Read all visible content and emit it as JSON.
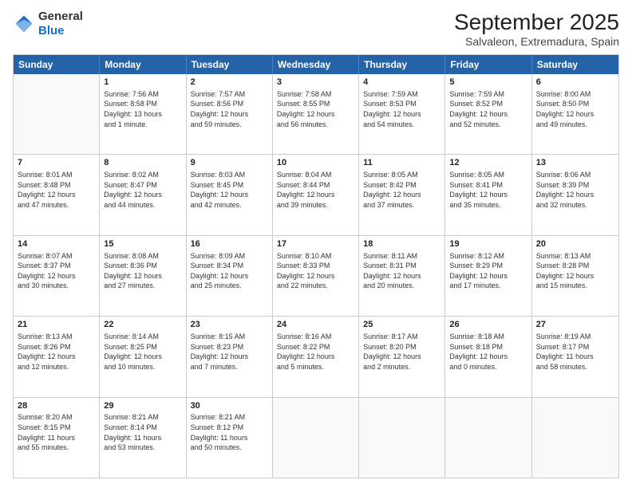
{
  "header": {
    "logo_line1": "General",
    "logo_line2": "Blue",
    "month_title": "September 2025",
    "subtitle": "Salvaleon, Extremadura, Spain"
  },
  "days": [
    "Sunday",
    "Monday",
    "Tuesday",
    "Wednesday",
    "Thursday",
    "Friday",
    "Saturday"
  ],
  "weeks": [
    [
      {
        "day": "",
        "content": ""
      },
      {
        "day": "1",
        "content": "Sunrise: 7:56 AM\nSunset: 8:58 PM\nDaylight: 13 hours\nand 1 minute."
      },
      {
        "day": "2",
        "content": "Sunrise: 7:57 AM\nSunset: 8:56 PM\nDaylight: 12 hours\nand 59 minutes."
      },
      {
        "day": "3",
        "content": "Sunrise: 7:58 AM\nSunset: 8:55 PM\nDaylight: 12 hours\nand 56 minutes."
      },
      {
        "day": "4",
        "content": "Sunrise: 7:59 AM\nSunset: 8:53 PM\nDaylight: 12 hours\nand 54 minutes."
      },
      {
        "day": "5",
        "content": "Sunrise: 7:59 AM\nSunset: 8:52 PM\nDaylight: 12 hours\nand 52 minutes."
      },
      {
        "day": "6",
        "content": "Sunrise: 8:00 AM\nSunset: 8:50 PM\nDaylight: 12 hours\nand 49 minutes."
      }
    ],
    [
      {
        "day": "7",
        "content": "Sunrise: 8:01 AM\nSunset: 8:48 PM\nDaylight: 12 hours\nand 47 minutes."
      },
      {
        "day": "8",
        "content": "Sunrise: 8:02 AM\nSunset: 8:47 PM\nDaylight: 12 hours\nand 44 minutes."
      },
      {
        "day": "9",
        "content": "Sunrise: 8:03 AM\nSunset: 8:45 PM\nDaylight: 12 hours\nand 42 minutes."
      },
      {
        "day": "10",
        "content": "Sunrise: 8:04 AM\nSunset: 8:44 PM\nDaylight: 12 hours\nand 39 minutes."
      },
      {
        "day": "11",
        "content": "Sunrise: 8:05 AM\nSunset: 8:42 PM\nDaylight: 12 hours\nand 37 minutes."
      },
      {
        "day": "12",
        "content": "Sunrise: 8:05 AM\nSunset: 8:41 PM\nDaylight: 12 hours\nand 35 minutes."
      },
      {
        "day": "13",
        "content": "Sunrise: 8:06 AM\nSunset: 8:39 PM\nDaylight: 12 hours\nand 32 minutes."
      }
    ],
    [
      {
        "day": "14",
        "content": "Sunrise: 8:07 AM\nSunset: 8:37 PM\nDaylight: 12 hours\nand 30 minutes."
      },
      {
        "day": "15",
        "content": "Sunrise: 8:08 AM\nSunset: 8:36 PM\nDaylight: 12 hours\nand 27 minutes."
      },
      {
        "day": "16",
        "content": "Sunrise: 8:09 AM\nSunset: 8:34 PM\nDaylight: 12 hours\nand 25 minutes."
      },
      {
        "day": "17",
        "content": "Sunrise: 8:10 AM\nSunset: 8:33 PM\nDaylight: 12 hours\nand 22 minutes."
      },
      {
        "day": "18",
        "content": "Sunrise: 8:11 AM\nSunset: 8:31 PM\nDaylight: 12 hours\nand 20 minutes."
      },
      {
        "day": "19",
        "content": "Sunrise: 8:12 AM\nSunset: 8:29 PM\nDaylight: 12 hours\nand 17 minutes."
      },
      {
        "day": "20",
        "content": "Sunrise: 8:13 AM\nSunset: 8:28 PM\nDaylight: 12 hours\nand 15 minutes."
      }
    ],
    [
      {
        "day": "21",
        "content": "Sunrise: 8:13 AM\nSunset: 8:26 PM\nDaylight: 12 hours\nand 12 minutes."
      },
      {
        "day": "22",
        "content": "Sunrise: 8:14 AM\nSunset: 8:25 PM\nDaylight: 12 hours\nand 10 minutes."
      },
      {
        "day": "23",
        "content": "Sunrise: 8:15 AM\nSunset: 8:23 PM\nDaylight: 12 hours\nand 7 minutes."
      },
      {
        "day": "24",
        "content": "Sunrise: 8:16 AM\nSunset: 8:22 PM\nDaylight: 12 hours\nand 5 minutes."
      },
      {
        "day": "25",
        "content": "Sunrise: 8:17 AM\nSunset: 8:20 PM\nDaylight: 12 hours\nand 2 minutes."
      },
      {
        "day": "26",
        "content": "Sunrise: 8:18 AM\nSunset: 8:18 PM\nDaylight: 12 hours\nand 0 minutes."
      },
      {
        "day": "27",
        "content": "Sunrise: 8:19 AM\nSunset: 8:17 PM\nDaylight: 11 hours\nand 58 minutes."
      }
    ],
    [
      {
        "day": "28",
        "content": "Sunrise: 8:20 AM\nSunset: 8:15 PM\nDaylight: 11 hours\nand 55 minutes."
      },
      {
        "day": "29",
        "content": "Sunrise: 8:21 AM\nSunset: 8:14 PM\nDaylight: 11 hours\nand 53 minutes."
      },
      {
        "day": "30",
        "content": "Sunrise: 8:21 AM\nSunset: 8:12 PM\nDaylight: 11 hours\nand 50 minutes."
      },
      {
        "day": "",
        "content": ""
      },
      {
        "day": "",
        "content": ""
      },
      {
        "day": "",
        "content": ""
      },
      {
        "day": "",
        "content": ""
      }
    ]
  ]
}
